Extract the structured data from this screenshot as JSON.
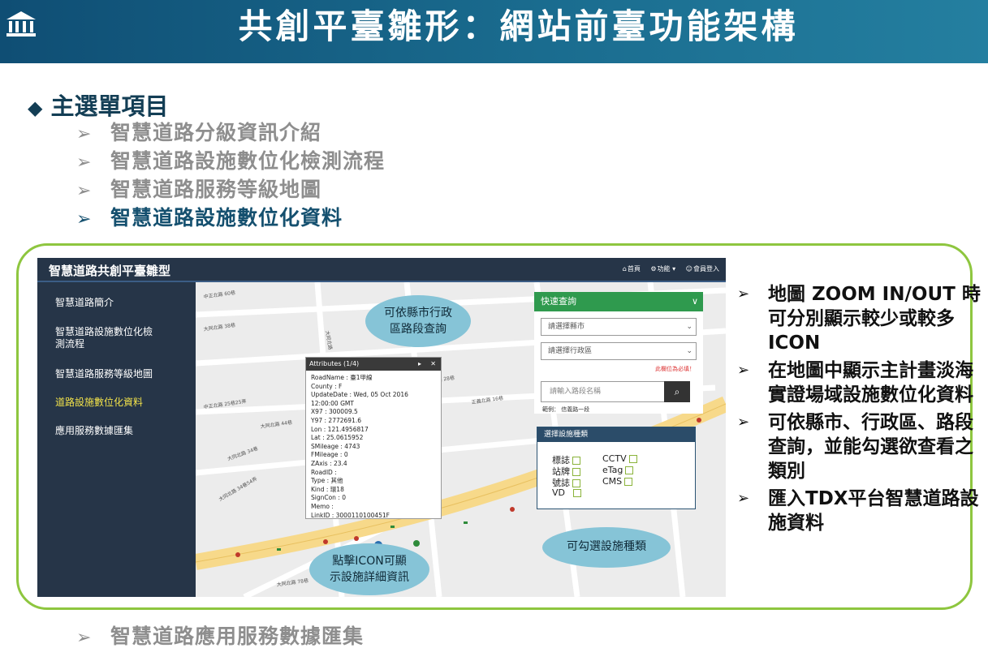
{
  "title": "共創平臺雛形：網站前臺功能架構",
  "main_heading": "主選單項目",
  "sub_items": [
    "智慧道路分級資訊介紹",
    "智慧道路設施數位化檢測流程",
    "智慧道路服務等級地圖",
    "智慧道路設施數位化資料"
  ],
  "last_item": "智慧道路應用服務數據匯集",
  "screenshot": {
    "app_title": "智慧道路共創平臺雛型",
    "nav": {
      "home": "首頁",
      "functions": "功能 ▾",
      "login": "會員登入"
    },
    "sidebar": [
      "智慧道路簡介",
      "智慧道路設施數位化檢",
      "測流程",
      "智慧道路服務等級地圖",
      "道路設施數位化資料",
      "應用服務數據匯集"
    ],
    "attributes": {
      "header": "Attributes (1/4)",
      "lines": [
        "RoadName : 臺1甲線",
        "County : F",
        "UpdateDate : Wed, 05 Oct 2016",
        "12:00:00 GMT",
        "X97 : 300009.5",
        "Y97 : 2772691.6",
        "Lon : 121.4956817",
        "Lat : 25.0615952",
        "SMileage : 4743",
        "FMileage : 0",
        "ZAxis : 23.4",
        "RoadID :",
        "Type : 其他",
        "Kind : 環18",
        "SignCon : 0",
        "Memo :",
        "LinkID : 3000110100451F"
      ]
    },
    "quick_search": {
      "header": "快速查詢",
      "county_placeholder": "請選擇縣市",
      "district_placeholder": "請選擇行政區",
      "required_note": "此欄位為必填！",
      "road_placeholder": "請輸入路段名稱",
      "example": "範例： 信義路一段"
    },
    "facility": {
      "header": "選擇設施種類",
      "left": [
        "標誌",
        "站牌",
        "號誌",
        "VD"
      ],
      "right": [
        "CCTV",
        "eTag",
        "CMS"
      ]
    },
    "bubbles": {
      "search": [
        "可依縣市行政",
        "區路段查詢"
      ],
      "icon": [
        "點擊ICON可顯",
        "示設施詳細資訊"
      ],
      "facility": "可勾選設施種類"
    },
    "map_labels": [
      "大同北路 38巷",
      "大同北路 44巷",
      "大同北路 34巷",
      "中正北路 25巷25弄",
      "正義北路 16巷",
      "正義北路 28巷",
      "大同北路 78巷",
      "大同北路 7巷",
      "大同北路 34巷54弄",
      "中正北路 60巷",
      "大同北路"
    ]
  },
  "notes": [
    "地圖 ZOOM IN/OUT 時可分別顯示較少或較多ICON",
    "在地圖中顯示主計畫淡海實證場域設施數位化資料",
    "可依縣市、行政區、路段查詢，並能勾選欲查看之類別",
    "匯入TDX平台智慧道路設施資料"
  ],
  "colors": {
    "banner": "#1a6c8f",
    "frame": "#8ec63f",
    "sidebar": "#263548",
    "panel_header": "#2f9a4e",
    "road": "#f7d98a"
  }
}
